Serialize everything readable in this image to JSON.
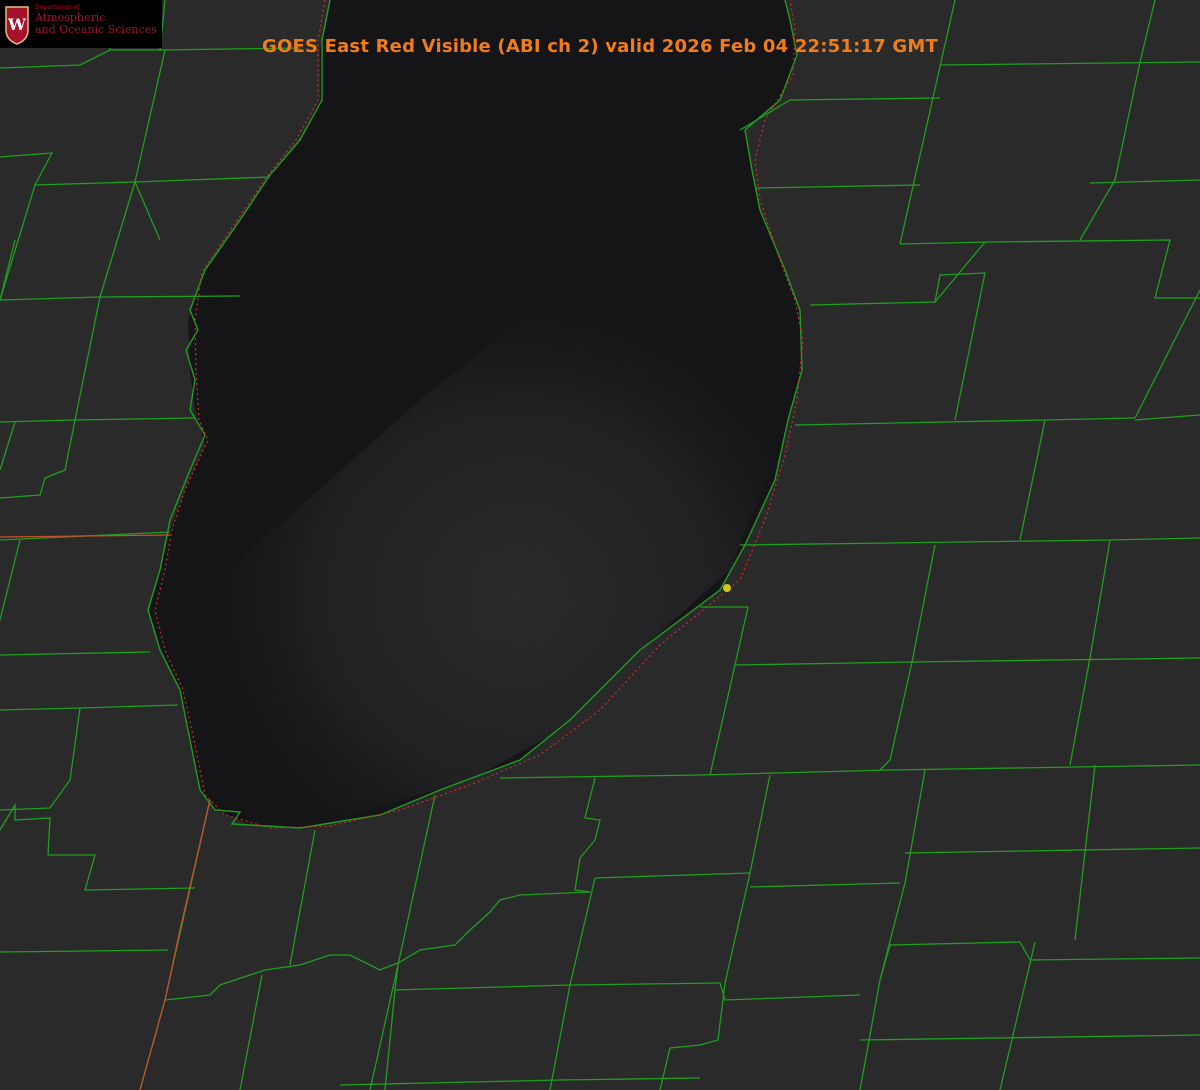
{
  "title": "GOES East Red Visible (ABI ch 2) valid 2026 Feb 04 22:51:17 GMT",
  "logo": {
    "dept": "Department of",
    "line1": "Atmospheric",
    "line2": "and Oceanic Sciences",
    "crest_letter": "W"
  },
  "colors": {
    "land": "#2a2a2b",
    "lake": "#151517",
    "county_lines": "#1f9e1f",
    "state_lines": "#c8502a",
    "lake_outline_dotted": "#d42a2a",
    "title": "#f07c1a",
    "marker": "#d9c21c",
    "logo_red": "#a5122b"
  },
  "icons": [
    "crest-icon",
    "station-marker-icon"
  ]
}
